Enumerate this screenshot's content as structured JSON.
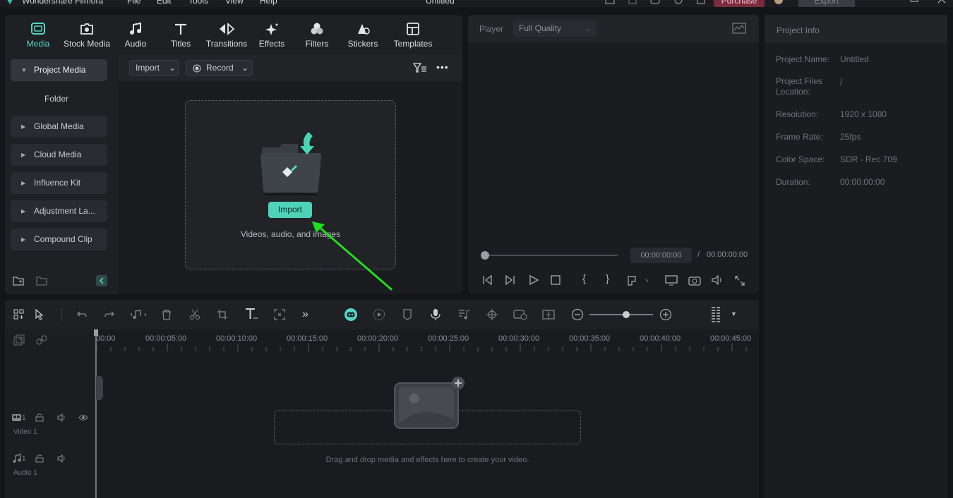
{
  "titlebar": {
    "app_name": "Wondershare Filmora",
    "menu": [
      "File",
      "Edit",
      "Tools",
      "View",
      "Help"
    ],
    "doc_title": "Untitled",
    "purchase_label": "Purchase",
    "export_label": "Export"
  },
  "tabs": [
    {
      "label": "Media",
      "icon": "media-icon",
      "active": true
    },
    {
      "label": "Stock Media",
      "icon": "stock-media-icon"
    },
    {
      "label": "Audio",
      "icon": "music-note-icon"
    },
    {
      "label": "Titles",
      "icon": "text-t-icon"
    },
    {
      "label": "Transitions",
      "icon": "transitions-icon"
    },
    {
      "label": "Effects",
      "icon": "sparkle-icon"
    },
    {
      "label": "Filters",
      "icon": "filters-icon"
    },
    {
      "label": "Stickers",
      "icon": "stickers-icon"
    },
    {
      "label": "Templates",
      "icon": "templates-icon"
    }
  ],
  "sidebar": {
    "items": [
      {
        "label": "Project Media",
        "expanded": true
      },
      {
        "label": "Folder"
      },
      {
        "label": "Global Media"
      },
      {
        "label": "Cloud Media"
      },
      {
        "label": "Influence Kit"
      },
      {
        "label": "Adjustment La..."
      },
      {
        "label": "Compound Clip"
      }
    ]
  },
  "media_toolbar": {
    "import_label": "Import",
    "record_label": "Record"
  },
  "import_zone": {
    "button_label": "Import",
    "hint": "Videos, audio, and images"
  },
  "player": {
    "label": "Player",
    "quality": "Full Quality",
    "current_time": "00:00:00:00",
    "separator": "/",
    "total_time": "00:00:00:00"
  },
  "project_info": {
    "title": "Project Info",
    "rows": [
      {
        "label": "Project Name:",
        "value": "Untitled"
      },
      {
        "label": "Project Files Location:",
        "value": "/"
      },
      {
        "label": "Resolution:",
        "value": "1920 x 1080"
      },
      {
        "label": "Frame Rate:",
        "value": "25fps"
      },
      {
        "label": "Color Space:",
        "value": "SDR - Rec.709"
      },
      {
        "label": "Duration:",
        "value": "00:00:00:00"
      }
    ]
  },
  "timeline": {
    "ruler": [
      "00:00",
      "00:00:05:00",
      "00:00:10:00",
      "00:00:15:00",
      "00:00:20:00",
      "00:00:25:00",
      "00:00:30:00",
      "00:00:35:00",
      "00:00:40:00",
      "00:00:45:00"
    ],
    "video_track": {
      "index": "1",
      "label": "Video 1"
    },
    "audio_track": {
      "index": "1",
      "label": "Audio 1"
    },
    "drop_hint": "Drag and drop media and effects here to create your video."
  },
  "colors": {
    "accent": "#53d6c6",
    "import_button": "#4ed3b9",
    "arrow": "#22dd22",
    "purchase": "#7a2b3c"
  }
}
